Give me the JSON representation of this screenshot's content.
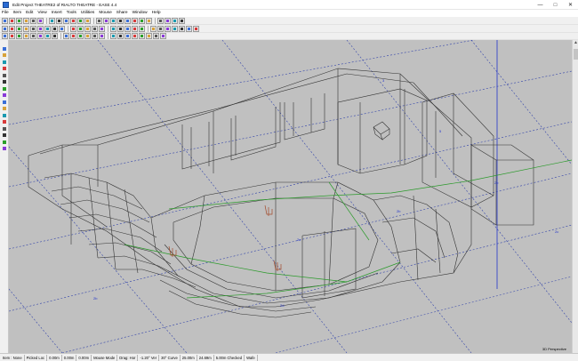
{
  "window": {
    "title": "Edit Project THEATRE2 of RIALTO THEATRE - EASE 4.4",
    "minimize_glyph": "—",
    "maximize_glyph": "□",
    "close_glyph": "✕"
  },
  "menu": {
    "items": [
      "File",
      "Item",
      "Edit",
      "View",
      "Insert",
      "Tools",
      "Utilities",
      "Mouse",
      "Share",
      "Window",
      "Help"
    ]
  },
  "viewport": {
    "label": "3D Perspective",
    "background": "#c0c0c0",
    "grid_color": "#3344aa",
    "wire_color": "#333333",
    "accent_green": "#2b9a2b",
    "marker_brown": "#a34a2a",
    "axis_blue": "#2233cc",
    "grid_labels": [
      "3",
      "5",
      "2b",
      "2c",
      "2b",
      "2b",
      "2c",
      "2d"
    ]
  },
  "status": {
    "cells": [
      "Item : None",
      "Picked Loc",
      "0.00m",
      "0.00m",
      "0.00m",
      "Mouse Mode",
      "Drag: Hor",
      "-1.20° Ver",
      "30° Curve",
      "25.00m",
      "24.69m",
      "5.00m Checked",
      "Wafe"
    ]
  }
}
